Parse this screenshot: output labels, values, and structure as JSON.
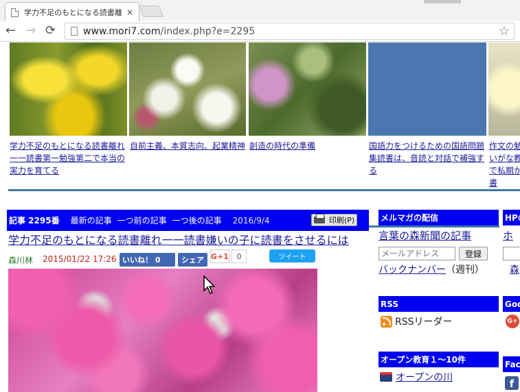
{
  "browser": {
    "tab_title": "学力不足のもとになる読書離",
    "tab_close": "×",
    "back": "←",
    "forward": "→",
    "reload": "⟳",
    "url_prefix": "www.mori7.com",
    "url_path": "/index.php?e=2295",
    "star": "☆"
  },
  "thumbnails": [
    {
      "caption": "学力不足のもとになる読書離れ一一読書第一勉強第二で本当の実力を育てる"
    },
    {
      "caption": "自前主義、本質志向、起業精神"
    },
    {
      "caption": "創造の時代の準備"
    },
    {
      "caption": "国語力をつけるための国語問題集読書は、音読と対話で補強する"
    },
    {
      "caption": "作文の勉合いがな教材で私期から書"
    }
  ],
  "article": {
    "number": "記事 2295番",
    "nav_latest": "最新の記事",
    "nav_prev": "一つ前の記事",
    "nav_next": "一つ後の記事",
    "date_top": "2016/9/4",
    "print_label": "印刷(P)",
    "title": "学力不足のもとになる読書離れ一一読書嫌いの子に読書をさせるには",
    "author": "森川林",
    "published": "2015/01/22 17:26",
    "like_label": "いいね！ 0",
    "share_label": "シェア",
    "gplus_label": "G+1",
    "gplus_count": "0",
    "tweet_label": "ツイート"
  },
  "sidebar": {
    "mailmag_head": "メルマガの配信",
    "hp_head": "HPの",
    "newspaper_link": "言葉の森新聞の記事",
    "mail_placeholder": "メールアドレス",
    "register_label": "登録",
    "backnumber_link": "バックナンバー",
    "backnumber_note": "（週刊）",
    "hp_link": "ホー",
    "hp_link2": "森",
    "rss_head": "RSS",
    "goo_head": "Goo",
    "rss_reader": "RSSリーダー",
    "goo_icon": "G+",
    "open_head": "オープン教育１〜10件",
    "open_link": "オープンの川",
    "fac_head": "Fac",
    "fb_icon": "f"
  }
}
